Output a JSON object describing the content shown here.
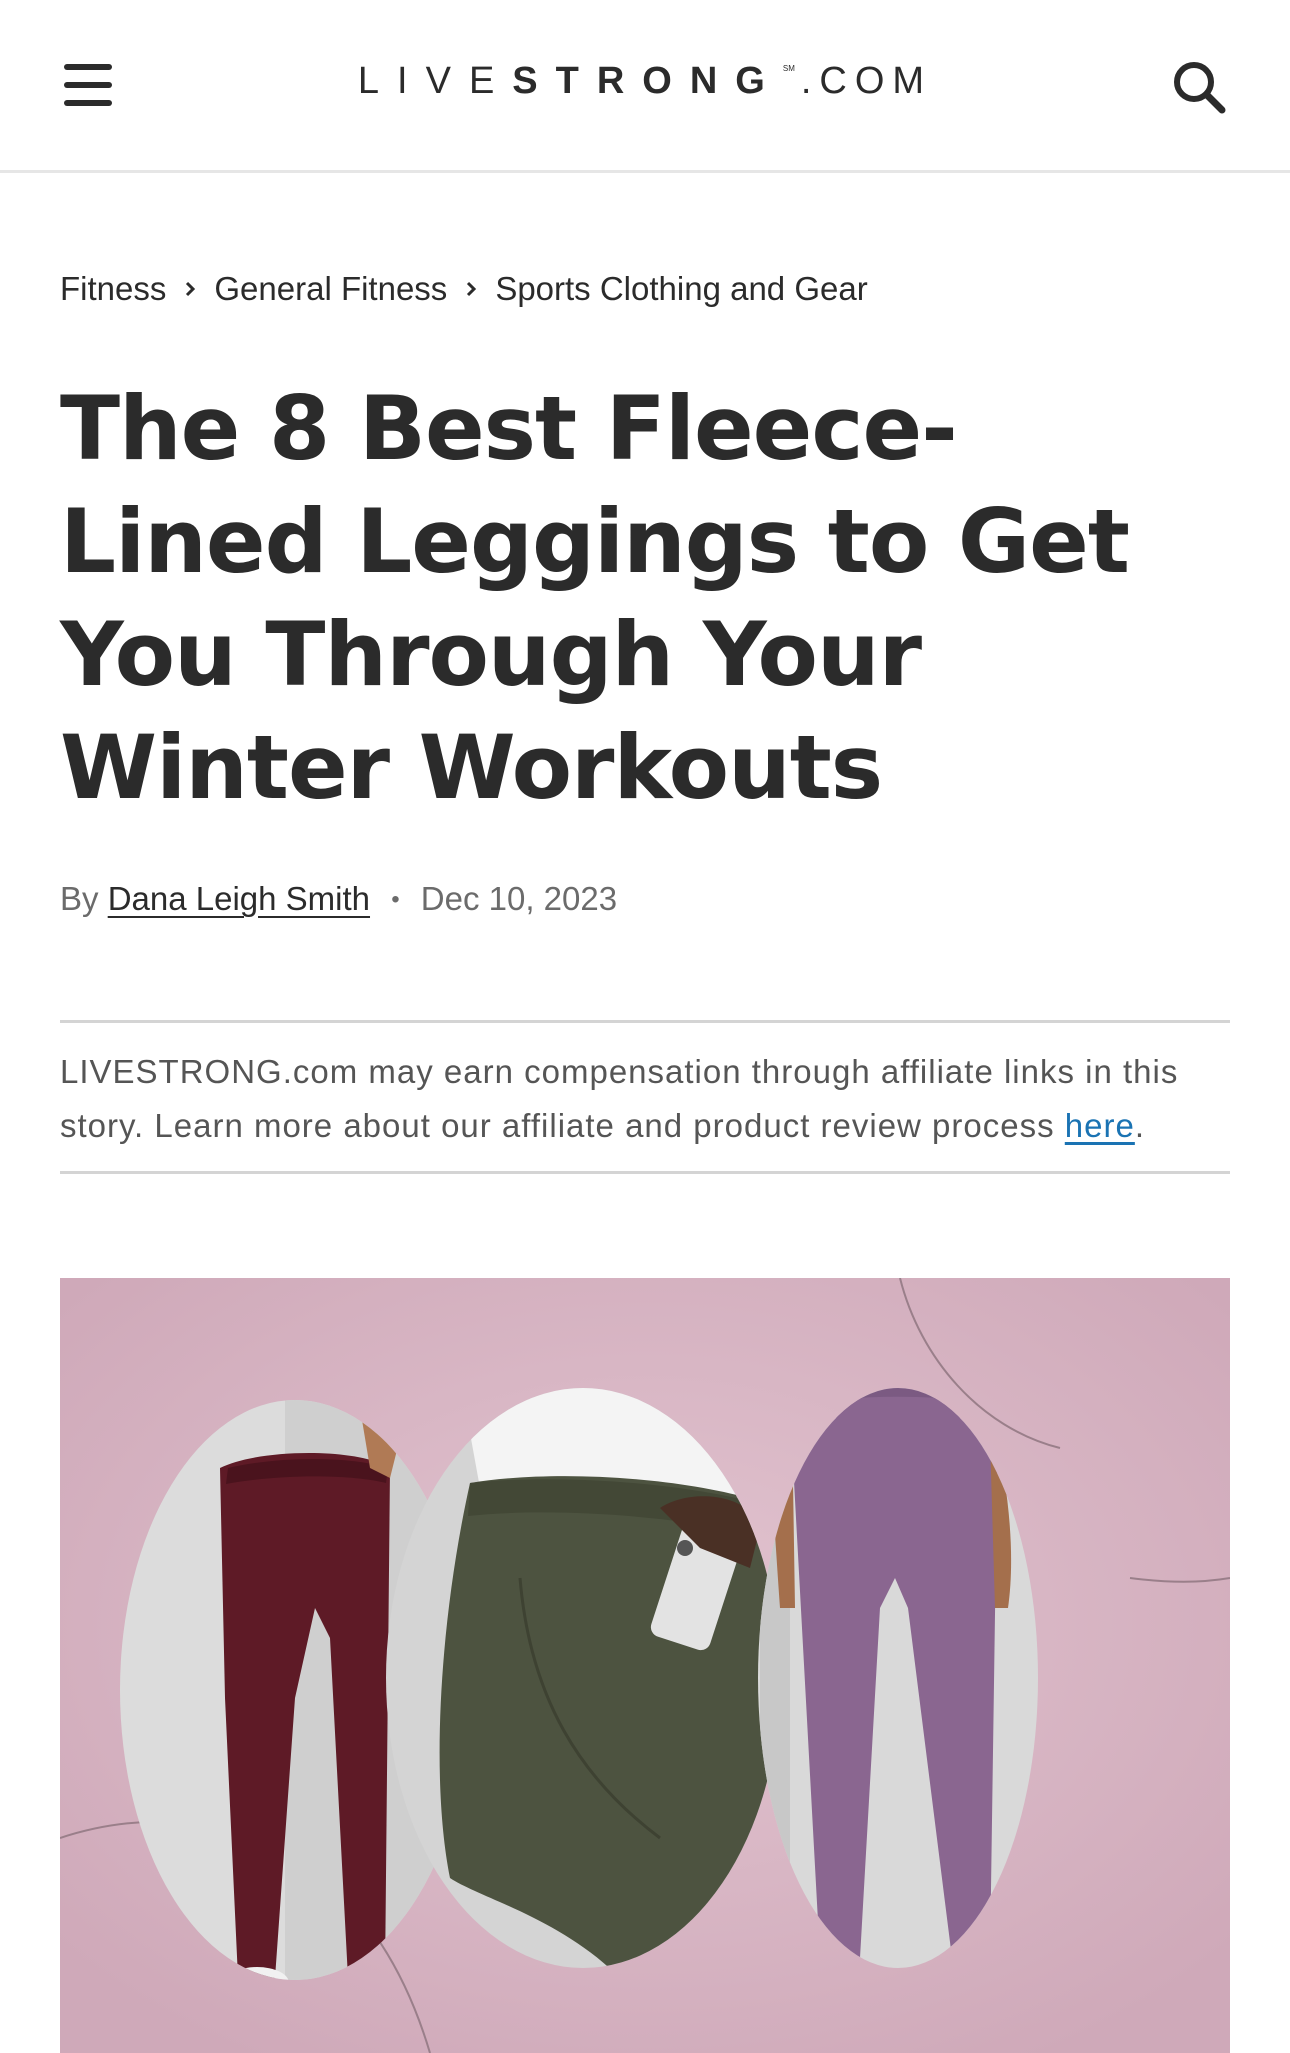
{
  "header": {
    "menu_icon": "hamburger-menu-icon",
    "logo": {
      "part1": "LIVE",
      "part2": "STRONG",
      "mark": "SM",
      "part3": ".COM"
    },
    "search_icon": "search-icon"
  },
  "breadcrumb": [
    {
      "label": "Fitness"
    },
    {
      "label": "General Fitness"
    },
    {
      "label": "Sports Clothing and Gear"
    }
  ],
  "article": {
    "title": "The 8 Best Fleece-Lined Leggings to Get You Through Your Winter Workouts",
    "byline_prefix": "By",
    "author": "Dana Leigh Smith",
    "separator": "•",
    "date": "Dec 10, 2023",
    "disclosure_text": "LIVESTRONG.com may earn compensation through affiliate links in this story. Learn more about our affiliate and product review process ",
    "disclosure_link": "here",
    "disclosure_end": "."
  },
  "colors": {
    "hero_background": "#d7b4c2",
    "link": "#1a73b3",
    "legging_burgundy": "#5e1a26",
    "legging_olive": "#4d5340",
    "legging_purple": "#8a6690"
  }
}
